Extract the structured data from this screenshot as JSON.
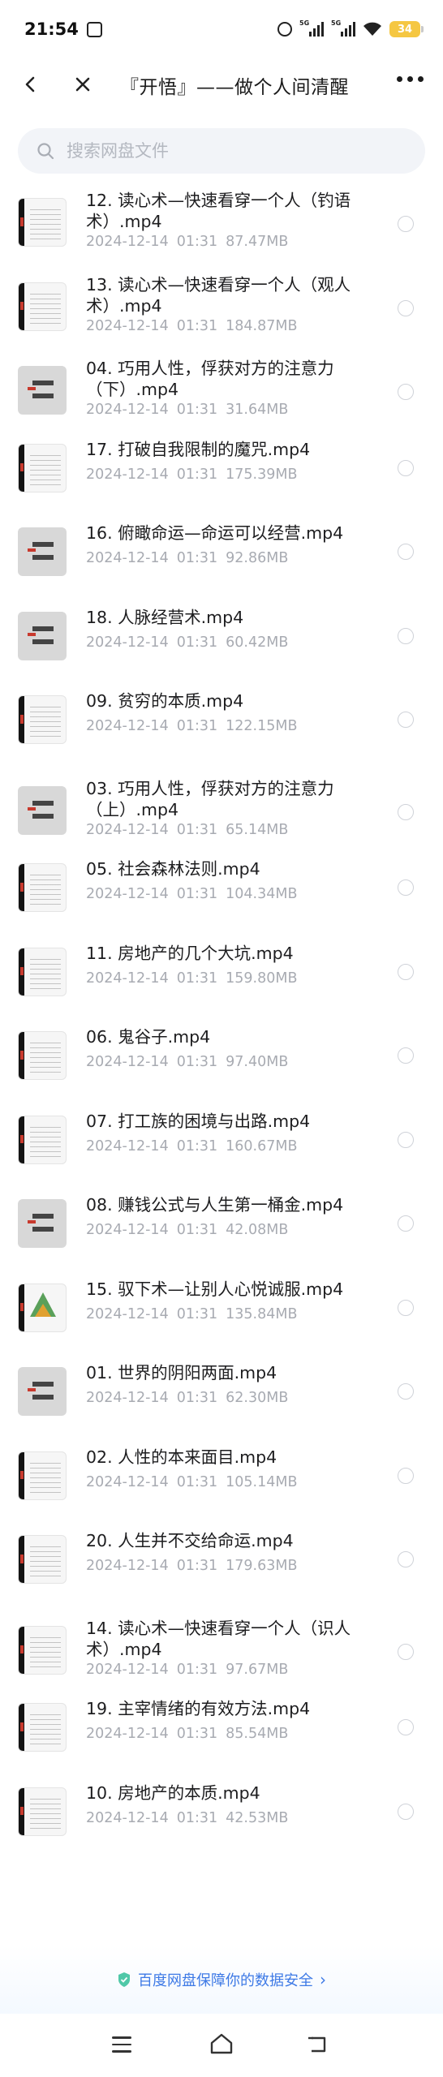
{
  "status_bar": {
    "time": "21:54",
    "signal1_tag": "5G",
    "signal2_tag": "5G",
    "battery": "34",
    "battery_color": "#f5c742"
  },
  "nav": {
    "back_icon": "chevron-left-icon",
    "close_icon": "close-icon",
    "title": "『开悟』——做个人间清醒",
    "more_icon": "more-dots-icon"
  },
  "search": {
    "placeholder": "搜索网盘文件",
    "icon": "search-icon"
  },
  "files": [
    {
      "name": "12. 读心术—快速看穿一个人（钓语术）.mp4",
      "date": "2024-12-14",
      "time": "01:31",
      "size": "87.47MB",
      "thumb": "dark-left"
    },
    {
      "name": "13. 读心术—快速看穿一个人（观人术）.mp4",
      "date": "2024-12-14",
      "time": "01:31",
      "size": "184.87MB",
      "thumb": "dark-left"
    },
    {
      "name": "04. 巧用人性，俘获对方的注意力（下）.mp4",
      "date": "2024-12-14",
      "time": "01:31",
      "size": "31.64MB",
      "thumb": "gray"
    },
    {
      "name": "17. 打破自我限制的魔咒.mp4",
      "date": "2024-12-14",
      "time": "01:31",
      "size": "175.39MB",
      "thumb": "dark-left"
    },
    {
      "name": "16. 俯瞰命运—命运可以经营.mp4",
      "date": "2024-12-14",
      "time": "01:31",
      "size": "92.86MB",
      "thumb": "gray"
    },
    {
      "name": "18. 人脉经营术.mp4",
      "date": "2024-12-14",
      "time": "01:31",
      "size": "60.42MB",
      "thumb": "gray"
    },
    {
      "name": "09. 贫穷的本质.mp4",
      "date": "2024-12-14",
      "time": "01:31",
      "size": "122.15MB",
      "thumb": "dark-left"
    },
    {
      "name": "03. 巧用人性，俘获对方的注意力（上）.mp4",
      "date": "2024-12-14",
      "time": "01:31",
      "size": "65.14MB",
      "thumb": "gray"
    },
    {
      "name": "05. 社会森林法则.mp4",
      "date": "2024-12-14",
      "time": "01:31",
      "size": "104.34MB",
      "thumb": "dark-left"
    },
    {
      "name": "11. 房地产的几个大坑.mp4",
      "date": "2024-12-14",
      "time": "01:31",
      "size": "159.80MB",
      "thumb": "dark-left"
    },
    {
      "name": "06. 鬼谷子.mp4",
      "date": "2024-12-14",
      "time": "01:31",
      "size": "97.40MB",
      "thumb": "dark-left"
    },
    {
      "name": "07. 打工族的困境与出路.mp4",
      "date": "2024-12-14",
      "time": "01:31",
      "size": "160.67MB",
      "thumb": "dark-left"
    },
    {
      "name": "08. 赚钱公式与人生第一桶金.mp4",
      "date": "2024-12-14",
      "time": "01:31",
      "size": "42.08MB",
      "thumb": "gray"
    },
    {
      "name": "15. 驭下术—让别人心悦诚服.mp4",
      "date": "2024-12-14",
      "time": "01:31",
      "size": "135.84MB",
      "thumb": "pyr"
    },
    {
      "name": "01. 世界的阴阳两面.mp4",
      "date": "2024-12-14",
      "time": "01:31",
      "size": "62.30MB",
      "thumb": "gray"
    },
    {
      "name": "02. 人性的本来面目.mp4",
      "date": "2024-12-14",
      "time": "01:31",
      "size": "105.14MB",
      "thumb": "dark-left"
    },
    {
      "name": "20. 人生并不交给命运.mp4",
      "date": "2024-12-14",
      "time": "01:31",
      "size": "179.63MB",
      "thumb": "dark-left"
    },
    {
      "name": "14. 读心术—快速看穿一个人（识人术）.mp4",
      "date": "2024-12-14",
      "time": "01:31",
      "size": "97.67MB",
      "thumb": "dark-left"
    },
    {
      "name": "19. 主宰情绪的有效方法.mp4",
      "date": "2024-12-14",
      "time": "01:31",
      "size": "85.54MB",
      "thumb": "dark-left"
    },
    {
      "name": "10. 房地产的本质.mp4",
      "date": "2024-12-14",
      "time": "01:31",
      "size": "42.53MB",
      "thumb": "dark-left"
    }
  ],
  "footer": {
    "text": "百度网盘保障你的数据安全",
    "chevron": "›",
    "accent": "#3e7ae6"
  },
  "system_nav": {
    "menu_icon": "menu-icon",
    "home_icon": "home-icon",
    "back_icon": "back-icon"
  }
}
